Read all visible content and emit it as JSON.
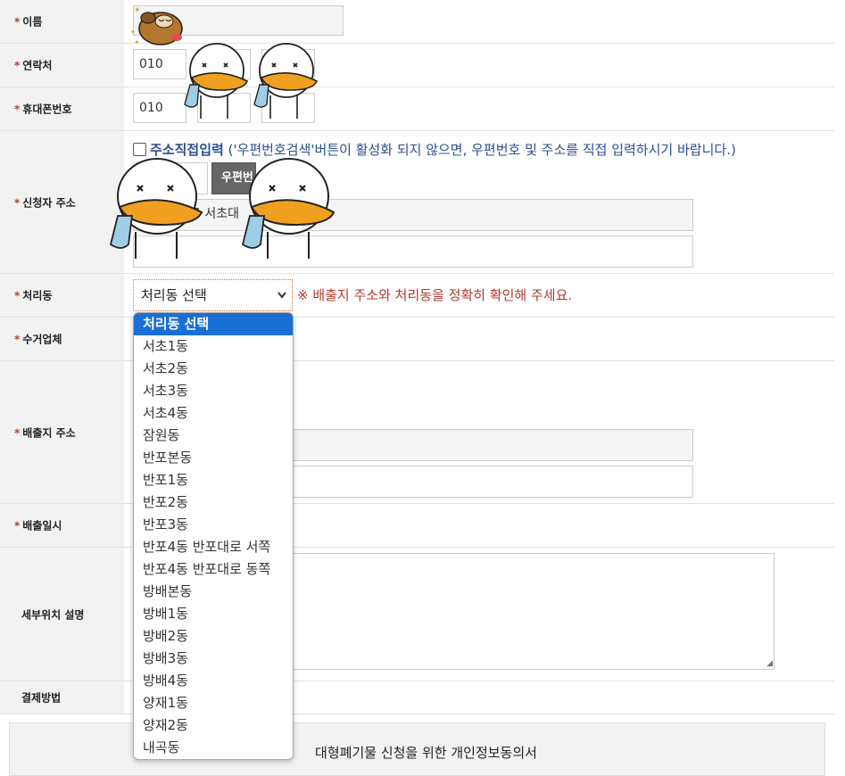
{
  "form": {
    "name_label": "이름",
    "contact_label": "연락처",
    "contact_prefix": "010",
    "mobile_label": "휴대폰번호",
    "mobile_prefix": "010",
    "applicant_address_label": "신청자 주소",
    "manual_address_label": "주소직접입력",
    "manual_address_note": "('우편번호검색'버튼이 활성화 되지 않으면, 우편번호 및 주소를 직접 입력하시기 바랍니다.)",
    "zipcode_button": "우편번",
    "address_value": "구 서초대",
    "dong_label": "처리동",
    "dong_selected": "처리동 선택",
    "dong_warning": "※ 배출지 주소와 처리동을 정확히 확인해 주세요.",
    "collector_label": "수거업체",
    "disposal_address_label": "배출지 주소",
    "disposal_date_label": "배출일시",
    "detail_location_label": "세부위치 설명",
    "payment_label": "결제방법",
    "consent_title": "대형폐기물 신청을 위한 개인정보동의서"
  },
  "dong_options": [
    "처리동 선택",
    "서초1동",
    "서초2동",
    "서초3동",
    "서초4동",
    "잠원동",
    "반포본동",
    "반포1동",
    "반포2동",
    "반포3동",
    "반포4동 반포대로 서쪽",
    "반포4동 반포대로 동쪽",
    "방배본동",
    "방배1동",
    "방배2동",
    "방배3동",
    "방배4동",
    "양재1동",
    "양재2동",
    "내곡동"
  ],
  "colors": {
    "required_star": "#c0392b",
    "selected_option": "#1a6fd6",
    "warning_text": "#b03a2e",
    "notice_blue": "#2a4f8d"
  },
  "stickers": [
    "dog-sticker",
    "duck-sticker"
  ]
}
